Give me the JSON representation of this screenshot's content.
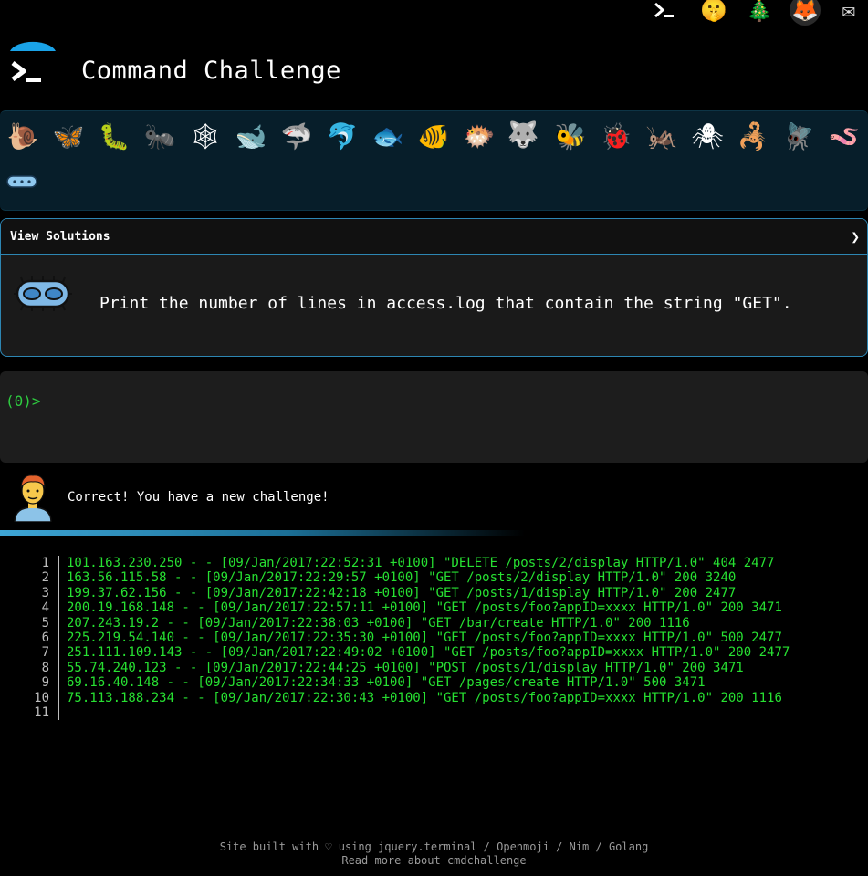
{
  "header": {
    "title": "Command Challenge"
  },
  "top_icons": [
    {
      "name": "terminal-icon",
      "glyph": ">_"
    },
    {
      "name": "shushing-face-icon",
      "glyph": "🤫"
    },
    {
      "name": "christmas-tree-icon",
      "glyph": "🎄"
    },
    {
      "name": "gitlab-icon",
      "glyph": "🦊"
    },
    {
      "name": "envelope-icon",
      "glyph": "✉"
    }
  ],
  "badges": [
    {
      "name": "snail-icon",
      "glyph": "🐌"
    },
    {
      "name": "butterfly-icon",
      "glyph": "🦋"
    },
    {
      "name": "caterpillar-icon",
      "glyph": "🐛"
    },
    {
      "name": "ant-icon",
      "glyph": "🐜"
    },
    {
      "name": "spider-web-icon",
      "glyph": "🕸"
    },
    {
      "name": "whale-icon",
      "glyph": "🐋"
    },
    {
      "name": "shark-icon",
      "glyph": "🦈"
    },
    {
      "name": "dolphin-icon",
      "glyph": "🐬"
    },
    {
      "name": "fish-icon",
      "glyph": "🐟"
    },
    {
      "name": "tropical-fish-icon",
      "glyph": "🐠"
    },
    {
      "name": "blowfish-icon",
      "glyph": "🐡"
    },
    {
      "name": "wolf-icon",
      "glyph": "🐺"
    },
    {
      "name": "bee-icon",
      "glyph": "🐝"
    },
    {
      "name": "ladybug-icon",
      "glyph": "🐞"
    },
    {
      "name": "cricket-icon",
      "glyph": "🦗"
    },
    {
      "name": "spider-icon",
      "glyph": "🕷"
    },
    {
      "name": "scorpion-icon",
      "glyph": "🦂"
    },
    {
      "name": "fly-icon",
      "glyph": "🪰"
    },
    {
      "name": "worm-icon",
      "glyph": "🪱"
    },
    {
      "name": "microbe-icon",
      "glyph": "🦠"
    }
  ],
  "challenge": {
    "view_solutions_label": "View Solutions",
    "chevron": "❯",
    "text": "Print the number of lines in access.log that contain the string \"GET\"."
  },
  "terminal": {
    "prompt": "(0)>"
  },
  "feedback": {
    "message": "Correct! You have a new challenge!"
  },
  "listing": {
    "lines": [
      {
        "n": "1",
        "text": "101.163.230.250 - - [09/Jan/2017:22:52:31 +0100] \"DELETE /posts/2/display HTTP/1.0\" 404 2477"
      },
      {
        "n": "2",
        "text": "163.56.115.58 - - [09/Jan/2017:22:29:57 +0100] \"GET /posts/2/display HTTP/1.0\" 200 3240"
      },
      {
        "n": "3",
        "text": "199.37.62.156 - - [09/Jan/2017:22:42:18 +0100] \"GET /posts/1/display HTTP/1.0\" 200 2477"
      },
      {
        "n": "4",
        "text": "200.19.168.148 - - [09/Jan/2017:22:57:11 +0100] \"GET /posts/foo?appID=xxxx HTTP/1.0\" 200 3471"
      },
      {
        "n": "5",
        "text": "207.243.19.2 - - [09/Jan/2017:22:38:03 +0100] \"GET /bar/create HTTP/1.0\" 200 1116"
      },
      {
        "n": "6",
        "text": "225.219.54.140 - - [09/Jan/2017:22:35:30 +0100] \"GET /posts/foo?appID=xxxx HTTP/1.0\" 500 2477"
      },
      {
        "n": "7",
        "text": "251.111.109.143 - - [09/Jan/2017:22:49:02 +0100] \"GET /posts/foo?appID=xxxx HTTP/1.0\" 200 2477"
      },
      {
        "n": "8",
        "text": "55.74.240.123 - - [09/Jan/2017:22:44:25 +0100] \"POST /posts/1/display HTTP/1.0\" 200 3471"
      },
      {
        "n": "9",
        "text": "69.16.40.148 - - [09/Jan/2017:22:34:33 +0100] \"GET /pages/create HTTP/1.0\" 500 3471"
      },
      {
        "n": "10",
        "text": "75.113.188.234 - - [09/Jan/2017:22:30:43 +0100] \"GET /posts/foo?appID=xxxx HTTP/1.0\" 200 1116"
      },
      {
        "n": "11",
        "text": ""
      }
    ]
  },
  "footer": {
    "line1": "Site built with ♡ using jquery.terminal / Openmoji / Nim / Golang",
    "line2": "Read more about cmdchallenge"
  }
}
